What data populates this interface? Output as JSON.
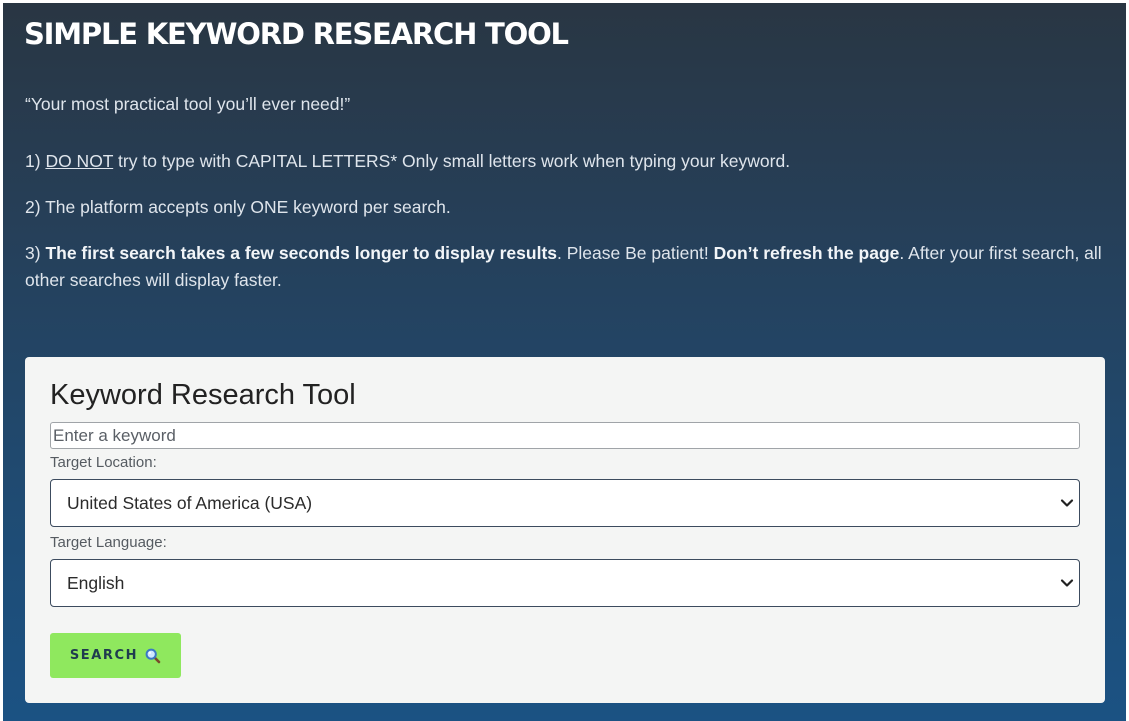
{
  "header": {
    "title": "SIMPLE KEYWORD RESEARCH TOOL"
  },
  "intro": {
    "quote": "“Your most practical tool you’ll ever need!”",
    "rule1": {
      "num": "1) ",
      "emph": "DO NOT",
      "rest": " try to type with CAPITAL LETTERS* Only small letters work when typing your keyword."
    },
    "rule2": "2) The platform accepts only ONE keyword per search.",
    "rule3": {
      "num": "3) ",
      "bold1": "The first search takes a few seconds longer to display results",
      "mid": ". Please Be patient! ",
      "bold2": "Don’t refresh the page",
      "end": ". After your first search, all other searches will display faster."
    }
  },
  "form": {
    "title": "Keyword Research Tool",
    "keyword_placeholder": "Enter a keyword",
    "keyword_value": "",
    "location_label": "Target Location:",
    "location_value": "United States of America (USA)",
    "language_label": "Target Language:",
    "language_value": "English",
    "search_label": "SEARCH"
  },
  "icons": {
    "select_arrow": "chevron-down-icon",
    "search": "magnifying-glass-icon"
  },
  "colors": {
    "search_button": "#8fe85e",
    "card_background": "#f4f5f4"
  }
}
